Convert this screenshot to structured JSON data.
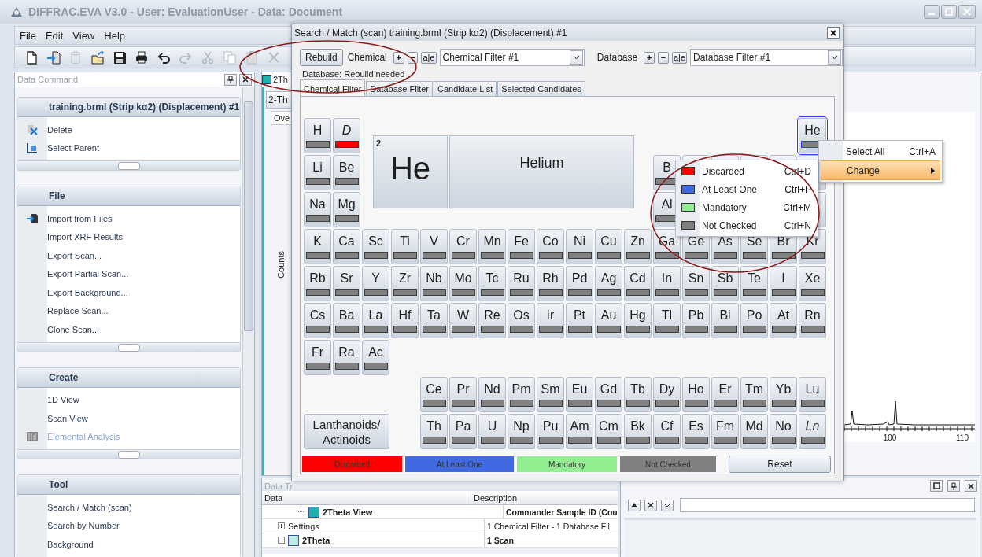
{
  "window": {
    "title": "DIFFRAC.EVA V3.0 - User: EvaluationUser - Data: Document"
  },
  "menu": [
    "File",
    "Edit",
    "View",
    "Help"
  ],
  "toolbar": [
    {
      "kind": "new",
      "disabled": false
    },
    {
      "kind": "import",
      "disabled": false
    },
    {
      "kind": "database",
      "disabled": true
    },
    {
      "kind": "open",
      "disabled": false
    },
    {
      "kind": "save",
      "disabled": false
    },
    {
      "kind": "print",
      "disabled": false
    },
    {
      "kind": "undo",
      "disabled": false
    },
    {
      "kind": "redo",
      "disabled": true
    },
    {
      "kind": "cut",
      "disabled": true
    },
    {
      "kind": "copy",
      "disabled": true
    },
    {
      "kind": "paste",
      "disabled": true
    },
    {
      "kind": "delete",
      "disabled": true
    }
  ],
  "data_command": {
    "title": "Data Command",
    "sections": [
      {
        "title": "training.brml (Strip kα2) (Displacement) #1",
        "items": [
          {
            "label": "Delete",
            "kind": "delete",
            "disabled": false
          },
          {
            "label": "Select Parent",
            "kind": "parent",
            "disabled": false
          }
        ]
      },
      {
        "title": "File",
        "items": [
          {
            "label": "Import from Files",
            "kind": "import",
            "disabled": false
          },
          {
            "label": "Import XRF Results",
            "kind": "plain",
            "disabled": false
          },
          {
            "label": "Export Scan...",
            "kind": "plain",
            "disabled": false
          },
          {
            "label": "Export Partial Scan...",
            "kind": "plain",
            "disabled": false
          },
          {
            "label": "Export Background...",
            "kind": "plain",
            "disabled": false
          },
          {
            "label": "Replace Scan...",
            "kind": "plain",
            "disabled": false
          },
          {
            "label": "Clone Scan...",
            "kind": "plain",
            "disabled": false
          }
        ]
      },
      {
        "title": "Create",
        "items": [
          {
            "label": "1D View",
            "kind": "plain",
            "disabled": false
          },
          {
            "label": "Scan View",
            "kind": "plain",
            "disabled": false
          },
          {
            "label": "Elemental Analysis",
            "kind": "analysis",
            "disabled": true
          }
        ]
      },
      {
        "title": "Tool",
        "items": [
          {
            "label": "Search / Match (scan)",
            "kind": "plain",
            "disabled": false
          },
          {
            "label": "Search by Number",
            "kind": "plain",
            "disabled": false
          },
          {
            "label": "Background",
            "kind": "plain",
            "disabled": false
          }
        ]
      }
    ]
  },
  "document": {
    "view_title": "2Th",
    "tab": "2-Th",
    "subtab": "Ove",
    "y_axis_label": "Counts",
    "x_tick_labels": [
      "100",
      "110"
    ]
  },
  "data_tree": {
    "title": "Data Tr",
    "columns": [
      "Data",
      "Description"
    ],
    "rows": [
      {
        "name": "2Theta View",
        "description": "Commander Sample ID (Cou",
        "bold": true,
        "color": "#20b2aa"
      },
      {
        "name": "Settings",
        "description": "1 Chemical Filter - 1 Database Fil",
        "bold": false,
        "expanded": false
      },
      {
        "name": "2Theta",
        "description": "1 Scan",
        "bold": true,
        "expanded": true,
        "color": "#bdebe6"
      }
    ]
  },
  "dialog": {
    "title": "Search / Match (scan) training.brml (Strip kα2) (Displacement) #1",
    "rebuild_button": "Rebuild",
    "chemical": {
      "label": "Chemical",
      "add": "+",
      "remove": "−",
      "rename": "a|e",
      "filter": "Chemical Filter #1"
    },
    "database": {
      "label": "Database",
      "add": "+",
      "remove": "−",
      "rename": "a|e",
      "filter": "Database Filter #1"
    },
    "status": "Database: Rebuild needed",
    "tabs": [
      {
        "label": "Chemical Filter",
        "selected": true
      },
      {
        "label": "Database Filter",
        "selected": false
      },
      {
        "label": "Candidate List",
        "selected": false
      },
      {
        "label": "Selected Candidates",
        "selected": false
      }
    ],
    "detail": {
      "number": "2",
      "symbol": "He",
      "name": "Helium"
    },
    "table_rows": [
      {
        "left": [
          {
            "kind": "element",
            "symbol": "H",
            "color": "#808080",
            "selected": false
          },
          {
            "kind": "pseudo",
            "symbol": "D",
            "color": "#ff0000",
            "selected": false
          }
        ],
        "right": [
          {
            "kind": "element",
            "symbol": "He",
            "color": "#808080",
            "selected": true
          }
        ]
      },
      {
        "left": [
          {
            "kind": "element",
            "symbol": "Li",
            "color": "#808080",
            "selected": false
          },
          {
            "kind": "element",
            "symbol": "Be",
            "color": "#808080",
            "selected": false
          }
        ],
        "right": [
          {
            "kind": "element",
            "symbol": "B",
            "color": "#808080",
            "selected": false
          },
          {
            "kind": "covered"
          },
          {
            "kind": "covered"
          },
          {
            "kind": "covered"
          },
          {
            "kind": "covered"
          },
          {
            "kind": "covered"
          }
        ]
      },
      {
        "left": [
          {
            "kind": "element",
            "symbol": "Na",
            "color": "#808080",
            "selected": false
          },
          {
            "kind": "element",
            "symbol": "Mg",
            "color": "#808080",
            "selected": false
          }
        ],
        "right": [
          {
            "kind": "element",
            "symbol": "Al",
            "color": "#808080",
            "selected": false
          },
          {
            "kind": "covered"
          },
          {
            "kind": "covered"
          },
          {
            "kind": "covered"
          },
          {
            "kind": "covered"
          },
          {
            "kind": "covered"
          }
        ]
      },
      {
        "left": [
          {
            "kind": "element",
            "symbol": "K",
            "color": "#808080",
            "selected": false
          },
          {
            "kind": "element",
            "symbol": "Ca",
            "color": "#808080",
            "selected": false
          },
          {
            "kind": "element",
            "symbol": "Sc",
            "color": "#808080",
            "selected": false
          },
          {
            "kind": "element",
            "symbol": "Ti",
            "color": "#808080",
            "selected": false
          },
          {
            "kind": "element",
            "symbol": "V",
            "color": "#808080",
            "selected": false
          },
          {
            "kind": "element",
            "symbol": "Cr",
            "color": "#808080",
            "selected": false
          },
          {
            "kind": "element",
            "symbol": "Mn",
            "color": "#808080",
            "selected": false
          },
          {
            "kind": "element",
            "symbol": "Fe",
            "color": "#808080",
            "selected": false
          },
          {
            "kind": "element",
            "symbol": "Co",
            "color": "#808080",
            "selected": false
          },
          {
            "kind": "element",
            "symbol": "Ni",
            "color": "#808080",
            "selected": false
          },
          {
            "kind": "element",
            "symbol": "Cu",
            "color": "#808080",
            "selected": false
          },
          {
            "kind": "element",
            "symbol": "Zn",
            "color": "#808080",
            "selected": false
          },
          {
            "kind": "element",
            "symbol": "Ga",
            "color": "#808080",
            "selected": false
          },
          {
            "kind": "element",
            "symbol": "Ge",
            "color": "#808080",
            "selected": false
          },
          {
            "kind": "element",
            "symbol": "As",
            "color": "#808080",
            "selected": false
          },
          {
            "kind": "element",
            "symbol": "Se",
            "color": "#808080",
            "selected": false
          },
          {
            "kind": "element",
            "symbol": "Br",
            "color": "#808080",
            "selected": false
          },
          {
            "kind": "element",
            "symbol": "Kr",
            "color": "#808080",
            "selected": false
          }
        ],
        "right": []
      },
      {
        "left": [
          {
            "kind": "element",
            "symbol": "Rb",
            "color": "#808080",
            "selected": false
          },
          {
            "kind": "element",
            "symbol": "Sr",
            "color": "#808080",
            "selected": false
          },
          {
            "kind": "element",
            "symbol": "Y",
            "color": "#808080",
            "selected": false
          },
          {
            "kind": "element",
            "symbol": "Zr",
            "color": "#808080",
            "selected": false
          },
          {
            "kind": "element",
            "symbol": "Nb",
            "color": "#808080",
            "selected": false
          },
          {
            "kind": "element",
            "symbol": "Mo",
            "color": "#808080",
            "selected": false
          },
          {
            "kind": "element",
            "symbol": "Tc",
            "color": "#808080",
            "selected": false
          },
          {
            "kind": "element",
            "symbol": "Ru",
            "color": "#808080",
            "selected": false
          },
          {
            "kind": "element",
            "symbol": "Rh",
            "color": "#808080",
            "selected": false
          },
          {
            "kind": "element",
            "symbol": "Pd",
            "color": "#808080",
            "selected": false
          },
          {
            "kind": "element",
            "symbol": "Ag",
            "color": "#808080",
            "selected": false
          },
          {
            "kind": "element",
            "symbol": "Cd",
            "color": "#808080",
            "selected": false
          },
          {
            "kind": "element",
            "symbol": "In",
            "color": "#808080",
            "selected": false
          },
          {
            "kind": "element",
            "symbol": "Sn",
            "color": "#808080",
            "selected": false
          },
          {
            "kind": "element",
            "symbol": "Sb",
            "color": "#808080",
            "selected": false
          },
          {
            "kind": "element",
            "symbol": "Te",
            "color": "#808080",
            "selected": false
          },
          {
            "kind": "element",
            "symbol": "I",
            "color": "#808080",
            "selected": false
          },
          {
            "kind": "element",
            "symbol": "Xe",
            "color": "#808080",
            "selected": false
          }
        ],
        "right": []
      },
      {
        "left": [
          {
            "kind": "element",
            "symbol": "Cs",
            "color": "#808080",
            "selected": false
          },
          {
            "kind": "element",
            "symbol": "Ba",
            "color": "#808080",
            "selected": false
          },
          {
            "kind": "element",
            "symbol": "La",
            "color": "#808080",
            "selected": false
          },
          {
            "kind": "element",
            "symbol": "Hf",
            "color": "#808080",
            "selected": false
          },
          {
            "kind": "element",
            "symbol": "Ta",
            "color": "#808080",
            "selected": false
          },
          {
            "kind": "element",
            "symbol": "W",
            "color": "#808080",
            "selected": false
          },
          {
            "kind": "element",
            "symbol": "Re",
            "color": "#808080",
            "selected": false
          },
          {
            "kind": "element",
            "symbol": "Os",
            "color": "#808080",
            "selected": false
          },
          {
            "kind": "element",
            "symbol": "Ir",
            "color": "#808080",
            "selected": false
          },
          {
            "kind": "element",
            "symbol": "Pt",
            "color": "#808080",
            "selected": false
          },
          {
            "kind": "element",
            "symbol": "Au",
            "color": "#808080",
            "selected": false
          },
          {
            "kind": "element",
            "symbol": "Hg",
            "color": "#808080",
            "selected": false
          },
          {
            "kind": "element",
            "symbol": "Tl",
            "color": "#808080",
            "selected": false
          },
          {
            "kind": "element",
            "symbol": "Pb",
            "color": "#808080",
            "selected": false
          },
          {
            "kind": "element",
            "symbol": "Bi",
            "color": "#808080",
            "selected": false
          },
          {
            "kind": "element",
            "symbol": "Po",
            "color": "#808080",
            "selected": false
          },
          {
            "kind": "element",
            "symbol": "At",
            "color": "#808080",
            "selected": false
          },
          {
            "kind": "element",
            "symbol": "Rn",
            "color": "#808080",
            "selected": false
          }
        ],
        "right": []
      },
      {
        "left": [
          {
            "kind": "element",
            "symbol": "Fr",
            "color": "#808080",
            "selected": false
          },
          {
            "kind": "element",
            "symbol": "Ra",
            "color": "#808080",
            "selected": false
          },
          {
            "kind": "element",
            "symbol": "Ac",
            "color": "#808080",
            "selected": false
          }
        ],
        "right": []
      },
      {
        "left": [],
        "right": [
          {
            "kind": "element",
            "symbol": "Ce",
            "color": "#808080",
            "selected": false
          },
          {
            "kind": "element",
            "symbol": "Pr",
            "color": "#808080",
            "selected": false
          },
          {
            "kind": "element",
            "symbol": "Nd",
            "color": "#808080",
            "selected": false
          },
          {
            "kind": "element",
            "symbol": "Pm",
            "color": "#808080",
            "selected": false
          },
          {
            "kind": "element",
            "symbol": "Sm",
            "color": "#808080",
            "selected": false
          },
          {
            "kind": "element",
            "symbol": "Eu",
            "color": "#808080",
            "selected": false
          },
          {
            "kind": "element",
            "symbol": "Gd",
            "color": "#808080",
            "selected": false
          },
          {
            "kind": "element",
            "symbol": "Tb",
            "color": "#808080",
            "selected": false
          },
          {
            "kind": "element",
            "symbol": "Dy",
            "color": "#808080",
            "selected": false
          },
          {
            "kind": "element",
            "symbol": "Ho",
            "color": "#808080",
            "selected": false
          },
          {
            "kind": "element",
            "symbol": "Er",
            "color": "#808080",
            "selected": false
          },
          {
            "kind": "element",
            "symbol": "Tm",
            "color": "#808080",
            "selected": false
          },
          {
            "kind": "element",
            "symbol": "Yb",
            "color": "#808080",
            "selected": false
          },
          {
            "kind": "element",
            "symbol": "Lu",
            "color": "#808080",
            "selected": false
          }
        ]
      },
      {
        "left": [],
        "right": [
          {
            "kind": "element",
            "symbol": "Th",
            "color": "#808080",
            "selected": false
          },
          {
            "kind": "element",
            "symbol": "Pa",
            "color": "#808080",
            "selected": false
          },
          {
            "kind": "element",
            "symbol": "U",
            "color": "#808080",
            "selected": false
          },
          {
            "kind": "element",
            "symbol": "Np",
            "color": "#808080",
            "selected": false
          },
          {
            "kind": "element",
            "symbol": "Pu",
            "color": "#808080",
            "selected": false
          },
          {
            "kind": "element",
            "symbol": "Am",
            "color": "#808080",
            "selected": false
          },
          {
            "kind": "element",
            "symbol": "Cm",
            "color": "#808080",
            "selected": false
          },
          {
            "kind": "element",
            "symbol": "Bk",
            "color": "#808080",
            "selected": false
          },
          {
            "kind": "element",
            "symbol": "Cf",
            "color": "#808080",
            "selected": false
          },
          {
            "kind": "element",
            "symbol": "Es",
            "color": "#808080",
            "selected": false
          },
          {
            "kind": "element",
            "symbol": "Fm",
            "color": "#808080",
            "selected": false
          },
          {
            "kind": "element",
            "symbol": "Md",
            "color": "#808080",
            "selected": false
          },
          {
            "kind": "element",
            "symbol": "No",
            "color": "#808080",
            "selected": false
          },
          {
            "kind": "pseudo",
            "symbol": "Ln",
            "color": "#808080",
            "selected": false
          }
        ]
      }
    ],
    "series_button": "Lanthanoids/\nActinoids",
    "legend": [
      {
        "label": "Discarded",
        "color": "#ff0000"
      },
      {
        "label": "At Least One",
        "color": "#4169e1"
      },
      {
        "label": "Mandatory",
        "color": "#90ee90"
      },
      {
        "label": "Not Checked",
        "color": "#808080"
      }
    ],
    "reset_button": "Reset"
  },
  "context_menu": {
    "items": [
      {
        "label": "Select All",
        "shortcut": "Ctrl+A",
        "submenu": false,
        "selected": false
      },
      {
        "label": "Change",
        "submenu": true,
        "selected": true
      }
    ]
  },
  "submenu": {
    "items": [
      {
        "label": "Discarded",
        "shortcut": "Ctrl+D",
        "color": "#ff0000"
      },
      {
        "label": "At Least One",
        "shortcut": "Ctrl+P",
        "color": "#4169e1"
      },
      {
        "label": "Mandatory",
        "shortcut": "Ctrl+M",
        "color": "#90ee90"
      },
      {
        "label": "Not Checked",
        "shortcut": "Ctrl+N",
        "color": "#808080"
      }
    ]
  }
}
